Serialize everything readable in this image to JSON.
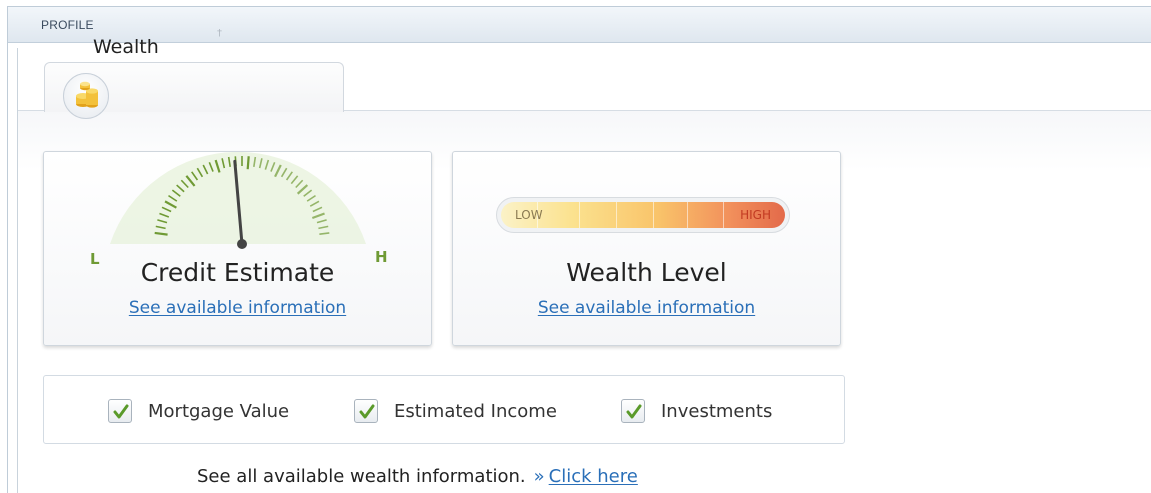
{
  "section": {
    "title": "PROFILE"
  },
  "tab": {
    "title": "Wealth",
    "marker": "†",
    "icon": "coin-stack-icon"
  },
  "credit_card": {
    "title": "Credit Estimate",
    "link": "See available information",
    "gauge": {
      "low_label": "L",
      "high_label": "H",
      "level": 0.47
    }
  },
  "wealth_card": {
    "title": "Wealth Level",
    "link": "See available information",
    "meter": {
      "low_label": "LOW",
      "high_label": "HIGH"
    }
  },
  "checks": [
    {
      "label": "Mortgage Value",
      "checked": true
    },
    {
      "label": "Estimated Income",
      "checked": true
    },
    {
      "label": "Investments",
      "checked": true
    }
  ],
  "footer": {
    "text": "See all available wealth information.",
    "arrow": "»",
    "link": "Click here"
  },
  "colors": {
    "link": "#2a6fb8",
    "gauge_green": "#6f9a34",
    "check_green": "#5a9a2a"
  }
}
